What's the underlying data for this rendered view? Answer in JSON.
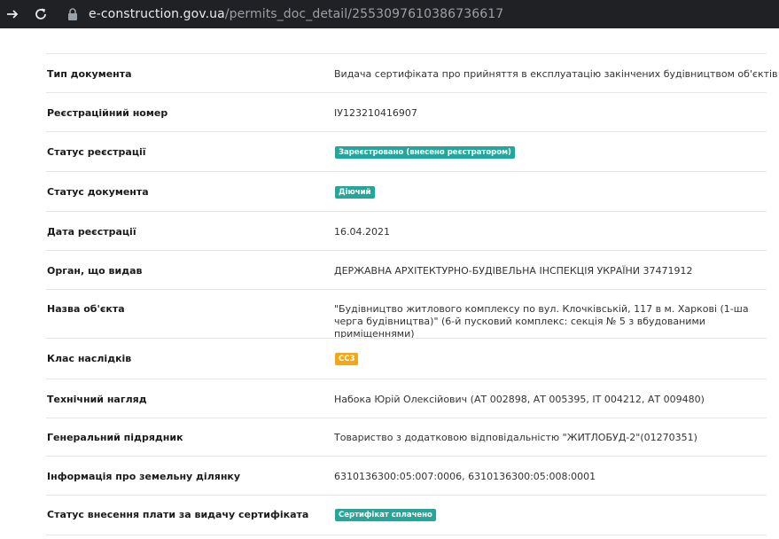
{
  "browser": {
    "url_host": "e-construction.gov.ua",
    "url_path": "/permits_doc_detail/2553097610386736617"
  },
  "colors": {
    "badge_teal": "#26a69a",
    "badge_orange": "#f0a818"
  },
  "details": {
    "doc_type": {
      "label": "Тип документа",
      "value": "Видача сертифіката про прийняття в експлуатацію закінчених будівництвом об'єктів"
    },
    "reg_number": {
      "label": "Реєстраційний номер",
      "value": "ІУ123210416907"
    },
    "reg_status": {
      "label": "Статус реєстрації",
      "badge": "Зареєстровано (внесено реєстратором)"
    },
    "doc_status": {
      "label": "Статус документа",
      "badge": "Діючий"
    },
    "reg_date": {
      "label": "Дата реєстрації",
      "value": "16.04.2021"
    },
    "issuer": {
      "label": "Орган, що видав",
      "value": "ДЕРЖАВНА АРХІТЕКТУРНО-БУДІВЕЛЬНА ІНСПЕКЦІЯ УКРАЇНИ 37471912"
    },
    "object_name": {
      "label": "Назва об'єкта",
      "value": "\"Будівництво житлового комплексу по вул. Клочківській, 117 в м. Харкові (1-ша черга будівництва)\" (6-й пусковий комплекс: секція № 5 з вбудованими приміщеннями)"
    },
    "consequence_class": {
      "label": "Клас наслідків",
      "badge": "СС3"
    },
    "tech_supervision": {
      "label": "Технічний нагляд",
      "value": "Набока Юрій Олексійович (АТ 002898, АТ 005395, ІТ 004212, АТ 009480)"
    },
    "general_contractor": {
      "label": "Генеральний підрядник",
      "value": "Товариство з додатковою відповідальністю \"ЖИТЛОБУД-2\"(01270351)"
    },
    "land_info": {
      "label": "Інформація про земельну ділянку",
      "value": "6310136300:05:007:0006, 6310136300:05:008:0001"
    },
    "payment_status": {
      "label": "Статус внесення плати за видачу сертифіката",
      "badge": "Сертифікат сплачено"
    }
  }
}
